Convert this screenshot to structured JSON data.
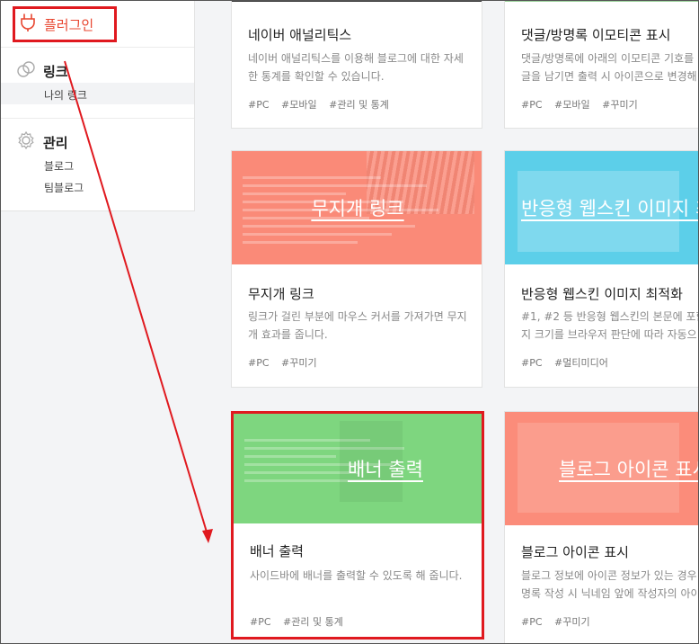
{
  "sidebar": {
    "plugin_label": "플러그인",
    "link_group": {
      "title": "링크",
      "items": [
        "나의 링크"
      ]
    },
    "manage_group": {
      "title": "관리",
      "items": [
        "블로그",
        "팀블로그"
      ]
    }
  },
  "cards": [
    {
      "title": "네이버 애널리틱스",
      "desc": "네이버 애널리틱스를 이용해 블로그에 대한 자세한 통계를 확인할 수 있습니다.",
      "tags": [
        "#PC",
        "#모바일",
        "#관리 및 통계"
      ]
    },
    {
      "title": "댓글/방명록 이모티콘 표시",
      "desc": "댓글/방명록에 아래의 이모티콘 기호를 글을 남기면 출력 시 아이콘으로 변경해",
      "tags": [
        "#PC",
        "#모바일",
        "#꾸미기"
      ]
    },
    {
      "thumb_title": "무지개 링크",
      "title": "무지개 링크",
      "desc": "링크가 걸린 부분에 마우스 커서를 가져가면 무지개 효과를 줍니다.",
      "tags": [
        "#PC",
        "#꾸미기"
      ]
    },
    {
      "thumb_title": "반응형 웹스킨 이미지 최",
      "title": "반응형 웹스킨 이미지 최적화",
      "desc": "#1, #2 등 반응형 웹스킨의 본문에 포함 지 크기를 브라우저 판단에 따라 자동으",
      "tags": [
        "#PC",
        "#멀티미디어"
      ]
    },
    {
      "thumb_title": "배너 출력",
      "title": "배너 출력",
      "desc": "사이드바에 배너를 출력할 수 있도록 해 줍니다.",
      "tags": [
        "#PC",
        "#관리 및 통계"
      ]
    },
    {
      "thumb_title": "블로그 아이콘 표시",
      "title": "블로그 아이콘 표시",
      "desc": "블로그 정보에 아이콘 정보가 있는 경우 명록 작성 시 닉네임 앞에 작성자의 아이",
      "tags": [
        "#PC",
        "#꾸미기"
      ]
    }
  ],
  "colors": {
    "accent_red": "#e0191f",
    "plugin_text": "#e8452f",
    "rainbow_thumb": "#fa8a78",
    "responsive_thumb": "#5ccfe9",
    "banner_thumb": "#7ed67f",
    "icon_thumb": "#fb8c7a"
  }
}
